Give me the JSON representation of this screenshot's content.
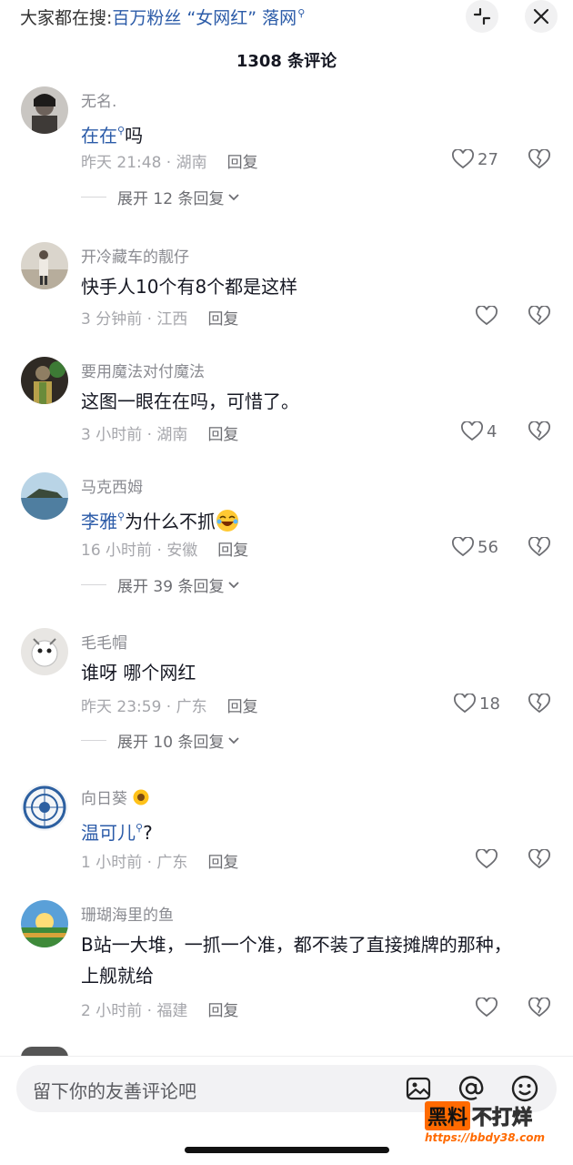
{
  "header": {
    "search_prefix": "大家都在搜:",
    "search_keyword": "百万粉丝 “女网红” 落网",
    "comment_count": "1308 条评论"
  },
  "comments": [
    {
      "user": "无名.",
      "kw": "在在",
      "text": "吗",
      "time": "昨天 21:48 · 湖南",
      "reply": "回复",
      "likes": "27",
      "expand": "展开 12 条回复"
    },
    {
      "user": "开冷藏车的靓仔",
      "text": "快手人10个有8个都是这样",
      "time": "3 分钟前 · 江西",
      "reply": "回复",
      "likes": ""
    },
    {
      "user": "要用魔法对付魔法",
      "text": "这图一眼在在吗，可惜了。",
      "time": "3 小时前 · 湖南",
      "reply": "回复",
      "likes": "4"
    },
    {
      "user": "马克西姆",
      "kw": "李雅",
      "text": "为什么不抓",
      "time": "16 小时前 · 安徽",
      "reply": "回复",
      "likes": "56",
      "expand": "展开 39 条回复"
    },
    {
      "user": "毛毛帽",
      "text": "谁呀 哪个网红",
      "time": "昨天 23:59 · 广东",
      "reply": "回复",
      "likes": "18",
      "expand": "展开 10 条回复"
    },
    {
      "user": "向日葵",
      "kw": "温可儿",
      "text": "?",
      "time": "1 小时前 · 广东",
      "reply": "回复",
      "likes": ""
    },
    {
      "user": "珊瑚海里的鱼",
      "text_line1": "B站一大堆，一抓一个准，都不装了直接摊牌的那种，",
      "text_line2": "上舰就给",
      "time": "2 小时前 · 福建",
      "reply": "回复",
      "likes": ""
    }
  ],
  "input": {
    "placeholder": "留下你的友善评论吧"
  },
  "watermark": {
    "brand_black": "黑料",
    "brand_white": "不打烊",
    "url": "https://bbdy38.com"
  },
  "icons": [
    "collapse-icon",
    "close-icon",
    "heart-icon",
    "broken-heart-icon",
    "chevron-down-icon",
    "image-icon",
    "at-icon",
    "emoji-icon"
  ],
  "colors": {
    "keyword": "#2b5ba8",
    "meta": "#a5a6ab",
    "username": "#8a8b91",
    "watermark_accent": "#ff6a00"
  }
}
